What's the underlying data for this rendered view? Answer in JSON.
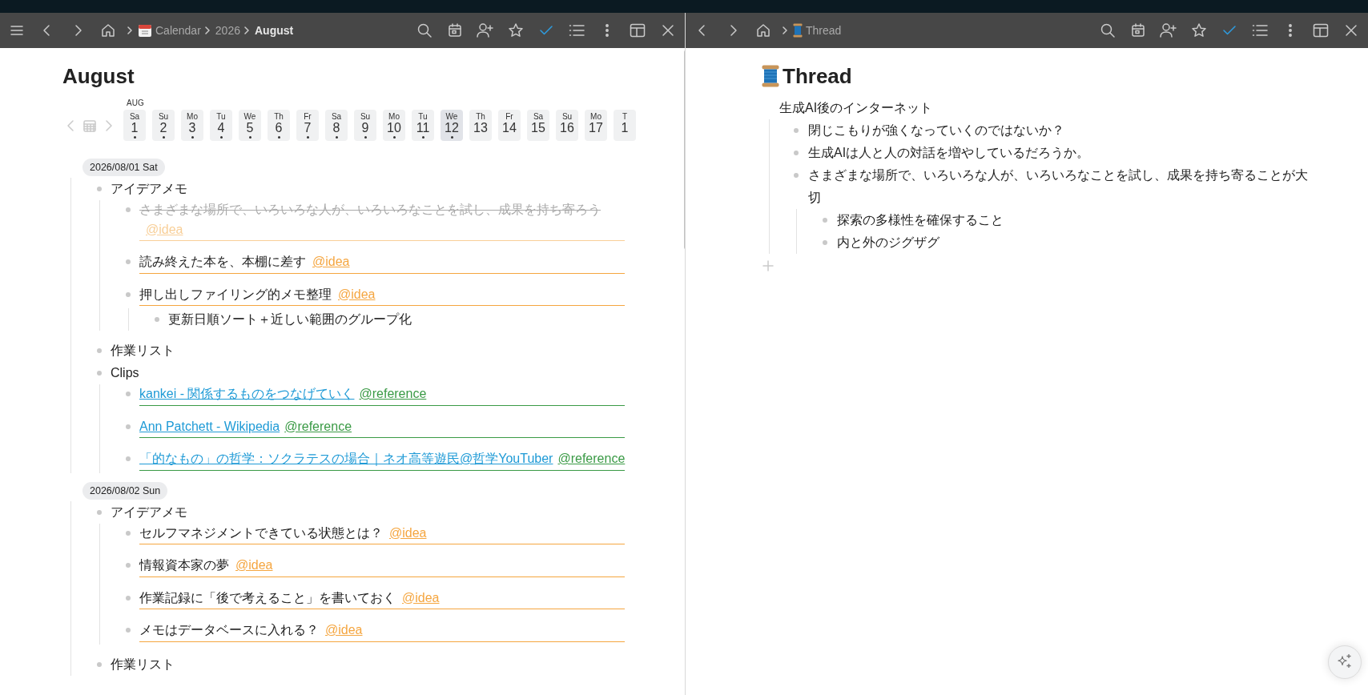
{
  "left_pane": {
    "breadcrumbs": [
      {
        "label": "Calendar",
        "current": false
      },
      {
        "label": "2026",
        "current": false
      },
      {
        "label": "August",
        "current": true
      }
    ],
    "title": "August",
    "month_label": "AUG",
    "days": [
      {
        "weekday": "Sa",
        "day": "1",
        "has_entries": true,
        "selected": false
      },
      {
        "weekday": "Su",
        "day": "2",
        "has_entries": true,
        "selected": false
      },
      {
        "weekday": "Mo",
        "day": "3",
        "has_entries": true,
        "selected": false
      },
      {
        "weekday": "Tu",
        "day": "4",
        "has_entries": true,
        "selected": false
      },
      {
        "weekday": "We",
        "day": "5",
        "has_entries": true,
        "selected": false
      },
      {
        "weekday": "Th",
        "day": "6",
        "has_entries": true,
        "selected": false
      },
      {
        "weekday": "Fr",
        "day": "7",
        "has_entries": true,
        "selected": false
      },
      {
        "weekday": "Sa",
        "day": "8",
        "has_entries": true,
        "selected": false
      },
      {
        "weekday": "Su",
        "day": "9",
        "has_entries": true,
        "selected": false
      },
      {
        "weekday": "Mo",
        "day": "10",
        "has_entries": true,
        "selected": false
      },
      {
        "weekday": "Tu",
        "day": "11",
        "has_entries": true,
        "selected": false
      },
      {
        "weekday": "We",
        "day": "12",
        "has_entries": true,
        "selected": true
      },
      {
        "weekday": "Th",
        "day": "13",
        "has_entries": false,
        "selected": false
      },
      {
        "weekday": "Fr",
        "day": "14",
        "has_entries": false,
        "selected": false
      },
      {
        "weekday": "Sa",
        "day": "15",
        "has_entries": false,
        "selected": false
      },
      {
        "weekday": "Su",
        "day": "16",
        "has_entries": false,
        "selected": false
      },
      {
        "weekday": "Mo",
        "day": "17",
        "has_entries": false,
        "selected": false
      },
      {
        "weekday": "T",
        "day": "1",
        "has_entries": false,
        "selected": false
      }
    ],
    "sections": [
      {
        "date": "2026/08/01 Sat",
        "items": [
          {
            "text": "アイデアメモ",
            "kind": "text",
            "done": false,
            "children": [
              {
                "text": "さまざまな場所で、いろいろな人が、いろいろなことを試し、成果を持ち寄ろう",
                "kind": "text",
                "done": true,
                "tag": {
                  "label": "@idea",
                  "color": "#f8cf98"
                }
              },
              {
                "text": "読み終えた本を、本棚に差す",
                "kind": "text",
                "done": false,
                "tag": {
                  "label": "@idea",
                  "color": "#f5a640"
                }
              },
              {
                "text": "押し出しファイリング的メモ整理",
                "kind": "text",
                "done": false,
                "tag": {
                  "label": "@idea",
                  "color": "#f5a640"
                },
                "children": [
                  {
                    "text": "更新日順ソート＋近しい範囲のグループ化",
                    "kind": "text",
                    "done": false
                  }
                ]
              }
            ]
          },
          {
            "text": "作業リスト",
            "kind": "text",
            "done": false
          },
          {
            "text": "Clips",
            "kind": "text",
            "done": false,
            "children": [
              {
                "text": "kankei - 関係するものをつなげていく",
                "kind": "link",
                "done": false,
                "tag": {
                  "label": "@reference",
                  "color": "#3a9a45"
                }
              },
              {
                "text": "Ann Patchett - Wikipedia",
                "kind": "link",
                "done": false,
                "tag": {
                  "label": "@reference",
                  "color": "#3a9a45"
                }
              },
              {
                "text": "「的なもの」の哲学：ソクラテスの場合｜ネオ高等遊民@哲学YouTuber",
                "kind": "link",
                "done": false,
                "tag": {
                  "label": "@reference",
                  "color": "#3a9a45"
                }
              }
            ]
          }
        ]
      },
      {
        "date": "2026/08/02 Sun",
        "items": [
          {
            "text": "アイデアメモ",
            "kind": "text",
            "done": false,
            "children": [
              {
                "text": "セルフマネジメントできている状態とは？",
                "kind": "text",
                "done": false,
                "tag": {
                  "label": "@idea",
                  "color": "#f5a640"
                }
              },
              {
                "text": "情報資本家の夢",
                "kind": "text",
                "done": false,
                "tag": {
                  "label": "@idea",
                  "color": "#f5a640"
                }
              },
              {
                "text": "作業記録に「後で考えること」を書いておく",
                "kind": "text",
                "done": false,
                "tag": {
                  "label": "@idea",
                  "color": "#f5a640"
                }
              },
              {
                "text": "メモはデータベースに入れる？",
                "kind": "text",
                "done": false,
                "tag": {
                  "label": "@idea",
                  "color": "#f5a640"
                }
              }
            ]
          },
          {
            "text": "作業リスト",
            "kind": "text",
            "done": false
          }
        ]
      }
    ]
  },
  "right_pane": {
    "breadcrumbs": [
      {
        "label": "Thread",
        "current": false
      }
    ],
    "title": "Thread",
    "root": {
      "text": "生成AI後のインターネット",
      "children": [
        {
          "text": "閉じこもりが強くなっていくのではないか？"
        },
        {
          "text": "生成AIは人と人の対話を増やしているだろうか。"
        },
        {
          "text": "さまざまな場所で、いろいろな人が、いろいろなことを試し、成果を持ち寄ることが大切",
          "children": [
            {
              "text": "探索の多様性を確保すること"
            },
            {
              "text": "内と外のジグザグ"
            }
          ]
        }
      ]
    }
  }
}
